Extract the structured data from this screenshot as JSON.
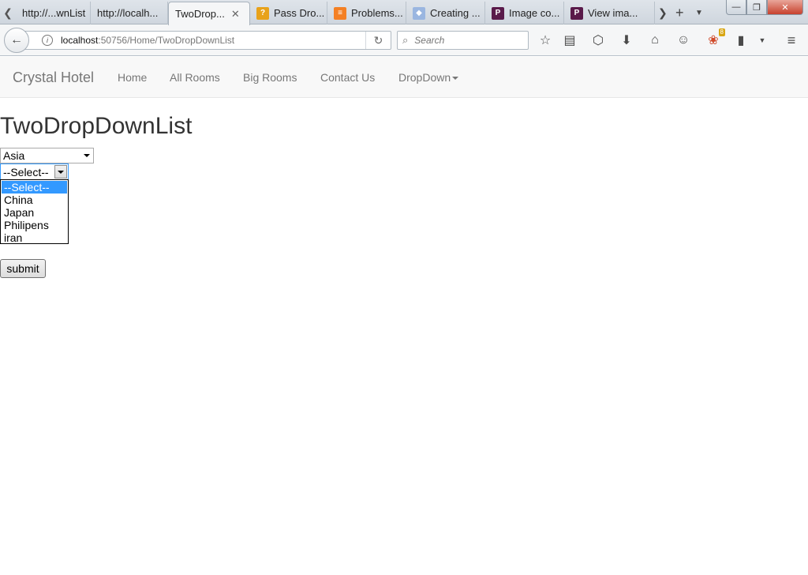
{
  "browser": {
    "tabs": [
      {
        "label": "http://...wnList",
        "icon": "none",
        "active": false
      },
      {
        "label": "http://localh...",
        "icon": "none",
        "active": false
      },
      {
        "label": "TwoDrop...",
        "icon": "none",
        "active": true
      },
      {
        "label": "Pass Dro...",
        "icon": "stackoverflow-icon",
        "active": false
      },
      {
        "label": "Problems...",
        "icon": "stackoverflow-icon",
        "active": false
      },
      {
        "label": "Creating ...",
        "icon": "generic-page-icon",
        "active": false
      },
      {
        "label": "Image co...",
        "icon": "p-logo-icon",
        "active": false
      },
      {
        "label": "View ima...",
        "icon": "p-logo-icon",
        "active": false
      }
    ],
    "url": {
      "host": "localhost",
      "path": ":50756/Home/TwoDropDownList"
    },
    "search_placeholder": "Search",
    "notification_count": "8"
  },
  "site": {
    "brand": "Crystal Hotel",
    "nav": [
      "Home",
      "All Rooms",
      "Big Rooms",
      "Contact Us",
      "DropDown"
    ]
  },
  "page": {
    "title": "TwoDropDownList",
    "region_select": {
      "value": "Asia"
    },
    "country_select": {
      "value": "--Select--",
      "options": [
        "--Select--",
        "China",
        "Japan",
        "Philipens",
        "iran"
      ],
      "highlighted": "--Select--"
    },
    "submit_label": "submit"
  },
  "colors": {
    "selection_blue": "#3399ff",
    "navbar_bg": "#f8f8f8",
    "nav_text": "#777777"
  }
}
